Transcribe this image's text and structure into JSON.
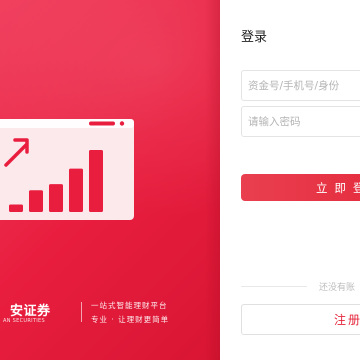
{
  "brand": {
    "name": "安证券",
    "name_en": "AN SECURITIES",
    "slogan_line1": "一站式智能理财平台",
    "slogan_line2": "专业 · 让理财更简单",
    "colors": {
      "primary": "#e91e3f",
      "primary_dark": "#d81533",
      "button": "#e5263b"
    }
  },
  "illustration": {
    "icon": "growth-bar-chart-icon",
    "bars": [
      0.12,
      0.35,
      0.45,
      0.7,
      1.0
    ]
  },
  "login": {
    "title": "登录",
    "account_placeholder": "资金号/手机号/身份",
    "password_placeholder": "请输入密码",
    "submit_label": "立即登",
    "no_account_text": "还没有账",
    "register_label": "注册"
  }
}
